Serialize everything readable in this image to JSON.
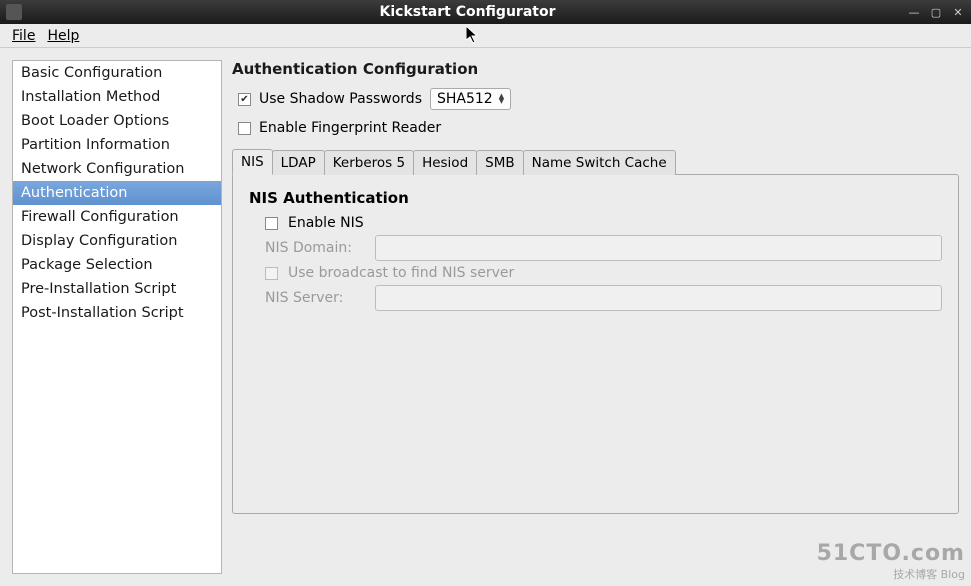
{
  "window": {
    "title": "Kickstart Configurator"
  },
  "menubar": {
    "file": "File",
    "help": "Help"
  },
  "sidebar": {
    "items": [
      "Basic Configuration",
      "Installation Method",
      "Boot Loader Options",
      "Partition Information",
      "Network Configuration",
      "Authentication",
      "Firewall Configuration",
      "Display Configuration",
      "Package Selection",
      "Pre-Installation Script",
      "Post-Installation Script"
    ],
    "selected_index": 5
  },
  "main": {
    "title": "Authentication Configuration",
    "use_shadow": {
      "label": "Use Shadow Passwords",
      "checked": true
    },
    "hash_select": {
      "value": "SHA512"
    },
    "enable_fingerprint": {
      "label": "Enable Fingerprint Reader",
      "checked": false
    },
    "tabs": [
      "NIS",
      "LDAP",
      "Kerberos 5",
      "Hesiod",
      "SMB",
      "Name Switch Cache"
    ],
    "active_tab": 0,
    "nis": {
      "title": "NIS Authentication",
      "enable": {
        "label": "Enable NIS",
        "checked": false
      },
      "domain_label": "NIS Domain:",
      "domain_value": "",
      "broadcast": {
        "label": "Use broadcast to find NIS server",
        "checked": false
      },
      "server_label": "NIS Server:",
      "server_value": ""
    }
  },
  "watermark": {
    "line1": "51CTO.com",
    "line2": "技术博客  Blog"
  }
}
